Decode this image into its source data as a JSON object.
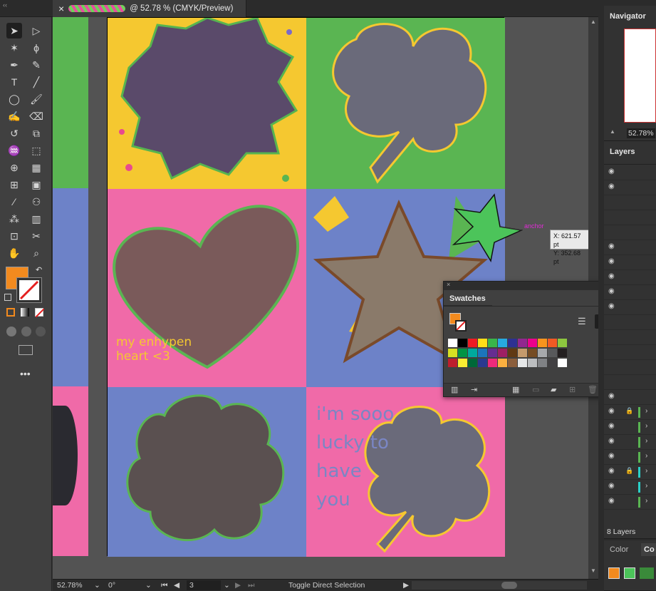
{
  "document_tab": {
    "title": "@ 52.78 % (CMYK/Preview)",
    "close": "×"
  },
  "navigator": {
    "title": "Navigator",
    "zoom": "52.78%"
  },
  "layers": {
    "title": "Layers",
    "count": "8 Layers"
  },
  "swatches": {
    "title": "Swatches"
  },
  "color_panel": {
    "tab1": "Color",
    "tab2": "Co"
  },
  "status": {
    "zoom": "52.78%",
    "rotation": "0°",
    "artboard": "3",
    "tool": "Toggle Direct Selection"
  },
  "cursor": {
    "label": "anchor",
    "x": "X: 621.57 pt",
    "y": "Y: 352.68 pt"
  },
  "artwork": {
    "text1": "my enhypen heart <3",
    "text2": "i'm sooo lucky to have you"
  },
  "colors": {
    "fill": "#f28a1e",
    "yellow": "#f5c830",
    "green": "#5ab552",
    "pink": "#f06aa8",
    "blue": "#6d82c8"
  },
  "swatch_colors": [
    [
      "#ffffff",
      "#000000",
      "#ed1c24",
      "#ffde17",
      "#39b54a",
      "#27aae1",
      "#2e3192",
      "#92278f",
      "#ec008c",
      "#f7941d",
      "#f15a24",
      "#8dc63f"
    ],
    [
      "#d7df23",
      "#009444",
      "#00a99d",
      "#1c75bc",
      "#662d91",
      "#9e1f63",
      "#603913",
      "#c49a6c",
      "#754c24",
      "#a7a9ac",
      "#58595b",
      "#231f20"
    ],
    [
      "#be1e2d",
      "#f9ed32",
      "#006838",
      "#2b3990",
      "#ee2a7b",
      "#fbb040",
      "#8b5e3c",
      "#e6e7e8",
      "#bcbec0",
      "#808285",
      "#414042",
      "#ffffff"
    ]
  ]
}
